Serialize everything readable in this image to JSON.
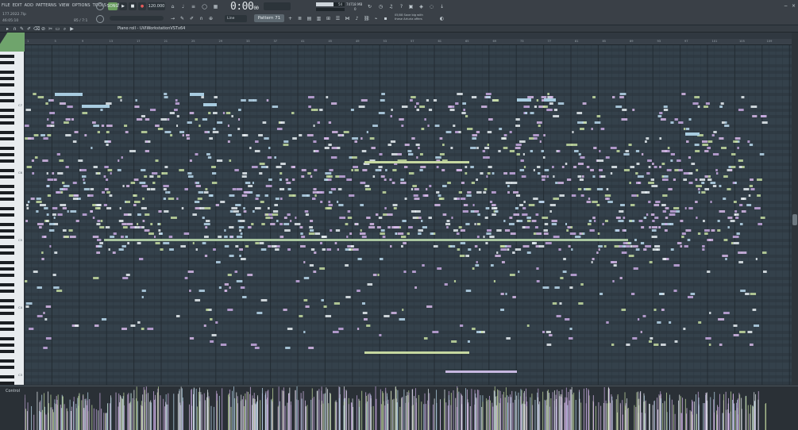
{
  "menu": [
    "FILE",
    "EDIT",
    "ADD",
    "PATTERNS",
    "VIEW",
    "OPTIONS",
    "TOOLS",
    "HELP"
  ],
  "status": {
    "left_a": "177.2022.7lp",
    "left_b": "46:05:10",
    "left_c": "85 / 7:1"
  },
  "transport": {
    "mode": "SONG",
    "tempo": "120.000"
  },
  "clock": {
    "time": "0:00",
    "sub": "00"
  },
  "meter": {
    "cpu": "54",
    "mem": "74718 MB",
    "poly": "0"
  },
  "toolbar": {
    "snap": "Line",
    "pattern": "Pattern 71"
  },
  "hint": {
    "line1": "05/08 Save big with",
    "line2": "these Arturia offers"
  },
  "piano_roll": {
    "title": "Piano roll - UVIWorkstationVSTx64",
    "header": "C4/A"
  },
  "ruler": {
    "bars": [
      "1",
      "5",
      "9",
      "13",
      "17",
      "21",
      "25",
      "29",
      "33",
      "37",
      "41",
      "45",
      "49",
      "53",
      "57",
      "61",
      "65",
      "69",
      "73",
      "77",
      "81",
      "85",
      "89",
      "93",
      "97",
      "101",
      "105",
      "109",
      "113"
    ]
  },
  "keyboard": {
    "labels": [
      "C7",
      "C6",
      "C5",
      "C4",
      "C3",
      "C2"
    ]
  },
  "control": {
    "label": "Control"
  },
  "colors": {
    "grid": "#34414b",
    "note_pink": "#d6b8e8",
    "note_blue": "#b8d8ec",
    "note_green": "#c4dca0",
    "note_white": "#e8eef2",
    "accent": "#6fa46c"
  }
}
